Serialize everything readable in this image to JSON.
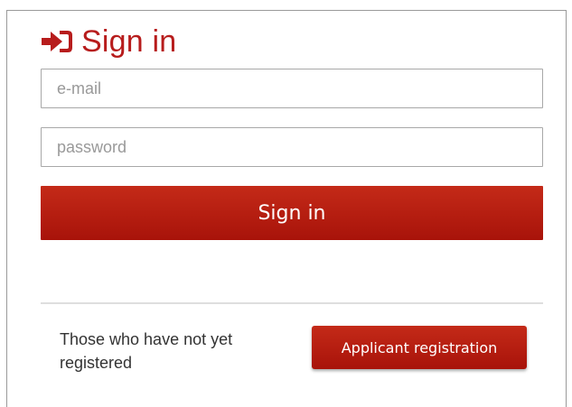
{
  "header": {
    "title": "Sign in",
    "icon": "sign-in-icon"
  },
  "form": {
    "email": {
      "placeholder": "e-mail",
      "value": ""
    },
    "password": {
      "placeholder": "password",
      "value": ""
    },
    "submit_label": "Sign in"
  },
  "registration": {
    "notice": "Those who have not yet registered",
    "button_label": "Applicant registration"
  },
  "colors": {
    "accent": "#b71c1c",
    "button": "#b3180d"
  }
}
